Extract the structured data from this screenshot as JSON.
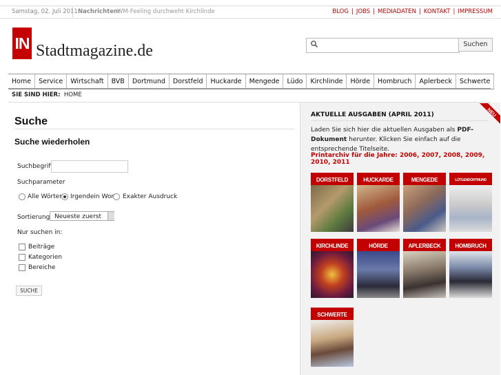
{
  "topbar": {
    "date": "Samstag, 02. Juli 2011",
    "news_label": "Nachrichten:",
    "news_text": "WM-Feeling durchweht Kirchlinde",
    "links": [
      "BLOG",
      "JOBS",
      "MEDIADATEN",
      "KONTAKT",
      "IMPRESSUM"
    ],
    "link_sep": "|"
  },
  "logo": {
    "badge": "IN",
    "name": "Stadtmagazine.de"
  },
  "search": {
    "placeholder": "",
    "button": "Suchen"
  },
  "nav": [
    "Home",
    "Service",
    "Wirtschaft",
    "BVB",
    "Dortmund",
    "Dorstfeld",
    "Huckarde",
    "Mengede",
    "Lüdo",
    "Kirchlinde",
    "Hörde",
    "Hombruch",
    "Aplerbeck",
    "Schwerte"
  ],
  "breadcrumb": {
    "label": "SIE SIND HIER:",
    "current": "HOME"
  },
  "main": {
    "title": "Suche",
    "subtitle": "Suche wiederholen",
    "field_label": "Suchbegriff",
    "field_value": "",
    "param_label": "Suchparameter",
    "radios": [
      {
        "label": "Alle Wörter",
        "checked": false
      },
      {
        "label": "Irgendein Wort",
        "checked": true
      },
      {
        "label": "Exakter Ausdruck",
        "checked": false
      }
    ],
    "sort_label": "Sortierung:",
    "sort_value": "Neueste zuerst",
    "only_label": "Nur suchen in:",
    "checkboxes": [
      "Beiträge",
      "Kategorien",
      "Bereiche"
    ],
    "submit": "SUCHE"
  },
  "sidebar": {
    "title": "AKTUELLE AUSGABEN (APRIL 2011)",
    "text_pre": "Laden Sie sich hier die aktuellen Ausgaben als ",
    "text_bold": "PDF-Dokument",
    "text_post": " herunter. Klicken Sie einfach auf die entsprechende Titelseite.",
    "archive_label": "Printarchiv für die Jahre:",
    "years": [
      "2006",
      "2007",
      "2008",
      "2009",
      "2010",
      "2011"
    ],
    "badge": "NEU",
    "covers": [
      "DORSTFELD",
      "HUCKARDE",
      "MENGEDE",
      "LÜTGENDORTMUND",
      "KIRCHLINDE",
      "HÖRDE",
      "APLERBECK",
      "HOMBRUCH",
      "SCHWERTE"
    ],
    "accent": "#c40000"
  }
}
